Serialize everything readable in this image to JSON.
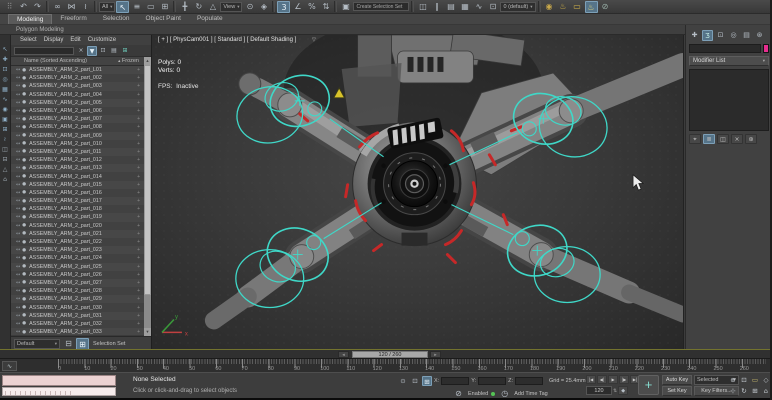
{
  "colors": {
    "accent_teal": "#3fd8c8",
    "marker_red": "#c62828",
    "object_color_swatch": "#e62e8f",
    "autokey": "#4a4a4a"
  },
  "toolbar_main": {
    "selection_set_placeholder": "Create Selection Set",
    "icons": [
      {
        "name": "toolbar-grip-icon",
        "glyph": "⠿",
        "color": "#7f7f7f"
      },
      {
        "name": "undo-icon",
        "glyph": "↶"
      },
      {
        "name": "redo-icon",
        "glyph": "↷"
      },
      {
        "type": "sep"
      },
      {
        "name": "select-and-link-icon",
        "glyph": "∞"
      },
      {
        "name": "unlink-selection-icon",
        "glyph": "⋈"
      },
      {
        "name": "bind-to-spacewarp-icon",
        "glyph": "≀"
      },
      {
        "type": "sep"
      },
      {
        "name": "selection-filter-dropdown",
        "type": "dropdown",
        "label": "All"
      },
      {
        "name": "select-object-icon",
        "glyph": "↖",
        "active": true
      },
      {
        "name": "select-by-name-icon",
        "glyph": "≡"
      },
      {
        "name": "selection-region-icon",
        "glyph": "▭"
      },
      {
        "name": "window-crossing-icon",
        "glyph": "⊞"
      },
      {
        "type": "sep"
      },
      {
        "name": "select-move-icon",
        "glyph": "╋"
      },
      {
        "name": "select-rotate-icon",
        "glyph": "↻"
      },
      {
        "name": "select-scale-icon",
        "glyph": "△"
      },
      {
        "name": "reference-coordinate-dropdown",
        "type": "dropdown",
        "label": "View"
      },
      {
        "name": "use-center-icon",
        "glyph": "⊙"
      },
      {
        "name": "select-manipulate-icon",
        "glyph": "◈"
      },
      {
        "type": "sep"
      },
      {
        "name": "snaps-toggle-icon",
        "glyph": "3",
        "active": true
      },
      {
        "name": "angle-snap-icon",
        "glyph": "∠"
      },
      {
        "name": "percent-snap-icon",
        "glyph": "%"
      },
      {
        "name": "spinner-snap-icon",
        "glyph": "⇅"
      },
      {
        "type": "sep"
      },
      {
        "name": "edit-named-sets-icon",
        "glyph": "▣"
      },
      {
        "name": "named-selection-set-field",
        "type": "input",
        "value": "Create Selection Set"
      },
      {
        "type": "sep"
      },
      {
        "name": "mirror-icon",
        "glyph": "◫"
      },
      {
        "name": "align-icon",
        "glyph": "∥"
      },
      {
        "name": "layer-manager-icon",
        "glyph": "▤"
      },
      {
        "name": "toggle-ribbon-icon",
        "glyph": "▦"
      },
      {
        "name": "curve-editor-icon",
        "glyph": "∿"
      },
      {
        "name": "schematic-view-icon",
        "glyph": "⊡"
      },
      {
        "name": "layer-dropdown",
        "type": "dropdown",
        "label": "0 (default)"
      },
      {
        "type": "sep"
      },
      {
        "name": "material-editor-icon",
        "glyph": "◉",
        "color": "#c8a84b"
      },
      {
        "name": "render-setup-icon",
        "glyph": "♨",
        "color": "#d8b84a"
      },
      {
        "name": "rendered-frame-window-icon",
        "glyph": "▭",
        "color": "#d8b84a"
      },
      {
        "name": "render-production-icon",
        "glyph": "♨",
        "color": "#eadc7a",
        "active": true
      },
      {
        "name": "render-iterative-icon",
        "glyph": "⊘",
        "color": "#9ab0a8"
      }
    ]
  },
  "ribbon": {
    "tabs": [
      {
        "label": "Modeling",
        "active": true
      },
      {
        "label": "Freeform",
        "active": false
      },
      {
        "label": "Selection",
        "active": false
      },
      {
        "label": "Object Paint",
        "active": false
      },
      {
        "label": "Populate",
        "active": false
      }
    ],
    "panel_label": "Polygon Modeling"
  },
  "explorer": {
    "menu": [
      "Select",
      "Display",
      "Edit",
      "Customize"
    ],
    "search_value": "",
    "search_icons": [
      {
        "name": "clear-search-icon",
        "glyph": "×"
      },
      {
        "name": "find-filter-icon",
        "glyph": "▼",
        "active": true
      },
      {
        "name": "lock-explorer-icon",
        "glyph": "⊡"
      },
      {
        "name": "sync-selection-icon",
        "glyph": "▤"
      },
      {
        "name": "pick-parent-icon",
        "glyph": "⊞",
        "color": "#6cc8b8"
      }
    ],
    "column_name": "Name (Sorted Ascending)",
    "sort_arrow": "▴",
    "column_frozen": "Frozen",
    "row_icons": {
      "link": "↔",
      "dot": "●",
      "frozen": "+"
    },
    "rows": [
      "ASSEMBLY_ARM_2_part_L01",
      "ASSEMBLY_ARM_2_part_002",
      "ASSEMBLY_ARM_2_part_003",
      "ASSEMBLY_ARM_2_part_004",
      "ASSEMBLY_ARM_2_part_005",
      "ASSEMBLY_ARM_2_part_006",
      "ASSEMBLY_ARM_2_part_007",
      "ASSEMBLY_ARM_2_part_008",
      "ASSEMBLY_ARM_2_part_009",
      "ASSEMBLY_ARM_2_part_010",
      "ASSEMBLY_ARM_2_part_011",
      "ASSEMBLY_ARM_2_part_012",
      "ASSEMBLY_ARM_2_part_013",
      "ASSEMBLY_ARM_2_part_014",
      "ASSEMBLY_ARM_2_part_015",
      "ASSEMBLY_ARM_2_part_016",
      "ASSEMBLY_ARM_2_part_017",
      "ASSEMBLY_ARM_2_part_018",
      "ASSEMBLY_ARM_2_part_019",
      "ASSEMBLY_ARM_2_part_020",
      "ASSEMBLY_ARM_2_part_021",
      "ASSEMBLY_ARM_2_part_022",
      "ASSEMBLY_ARM_2_part_023",
      "ASSEMBLY_ARM_2_part_024",
      "ASSEMBLY_ARM_2_part_025",
      "ASSEMBLY_ARM_2_part_026",
      "ASSEMBLY_ARM_2_part_027",
      "ASSEMBLY_ARM_2_part_028",
      "ASSEMBLY_ARM_2_part_029",
      "ASSEMBLY_ARM_2_part_030",
      "ASSEMBLY_ARM_2_part_031",
      "ASSEMBLY_ARM_2_part_032",
      "ASSEMBLY_ARM_2_part_033"
    ],
    "side_icons": [
      {
        "name": "explorer-select-icon",
        "glyph": "↖",
        "color": "#8fb0c8"
      },
      {
        "name": "explorer-pan-icon",
        "glyph": "✚",
        "color": "#8fb0c8"
      },
      {
        "name": "explorer-lock-icon",
        "glyph": "⊡",
        "color": "#8fb0c8"
      },
      {
        "name": "explorer-pin-icon",
        "glyph": "◎",
        "color": "#8fb0c8"
      },
      {
        "name": "explorer-geometry-icon",
        "glyph": "▦",
        "color": "#8fb0c8"
      },
      {
        "name": "explorer-shapes-icon",
        "glyph": "∿",
        "color": "#8fb0c8"
      },
      {
        "name": "explorer-lights-icon",
        "glyph": "◉",
        "color": "#8fb0c8"
      },
      {
        "name": "explorer-cameras-icon",
        "glyph": "▣",
        "color": "#8fb0c8"
      },
      {
        "name": "explorer-helpers-icon",
        "glyph": "⊞",
        "color": "#8fb0c8"
      },
      {
        "name": "explorer-spacewarps-icon",
        "glyph": "≀",
        "color": "#8fb0c8"
      },
      {
        "name": "explorer-groups-icon",
        "glyph": "◫",
        "color": "#9aa5ad"
      },
      {
        "name": "explorer-xrefs-icon",
        "glyph": "⊟",
        "color": "#9aa5ad"
      },
      {
        "name": "explorer-bones-icon",
        "glyph": "△",
        "color": "#9aa5ad"
      },
      {
        "name": "explorer-containers-icon",
        "glyph": "⌂",
        "color": "#9aa5ad"
      }
    ],
    "footer_dropdown": "Default",
    "footer_icons": [
      {
        "name": "delete-set-icon",
        "glyph": "⊟"
      },
      {
        "name": "new-set-icon",
        "glyph": "⊞",
        "active": true
      }
    ],
    "footer_label": "Selection Set"
  },
  "viewport": {
    "label": "[ + ] [ PhysCam001 ] [ Standard ] [ Default Shading ]",
    "funnel": "▽",
    "stats": {
      "polys_label": "Polys:",
      "polys": "0",
      "verts_label": "Verts:",
      "verts": "0",
      "fps_label": "FPS:",
      "fps": "Inactive"
    }
  },
  "command_panel": {
    "tabs": [
      {
        "name": "create-tab-icon",
        "glyph": "✚"
      },
      {
        "name": "modify-tab-icon",
        "glyph": "Ʒ",
        "active": true,
        "color": "#bfe8e2"
      },
      {
        "name": "hierarchy-tab-icon",
        "glyph": "⊡"
      },
      {
        "name": "motion-tab-icon",
        "glyph": "◎"
      },
      {
        "name": "display-tab-icon",
        "glyph": "▤"
      },
      {
        "name": "utilities-tab-icon",
        "glyph": "⊛"
      }
    ],
    "object_name_value": "",
    "modifier_list_label": "Modifier List",
    "stack_buttons": [
      {
        "name": "pin-stack-icon",
        "glyph": "⌖"
      },
      {
        "name": "show-end-result-icon",
        "glyph": "≣",
        "active": true
      },
      {
        "name": "make-unique-icon",
        "glyph": "◫"
      },
      {
        "name": "remove-modifier-icon",
        "glyph": "×"
      },
      {
        "name": "configure-modifier-icon",
        "glyph": "⊛"
      }
    ]
  },
  "timeline": {
    "slider_label": "120 / 260",
    "tick_start": 0,
    "tick_end": 260,
    "tick_step": 10
  },
  "status": {
    "selected": "None Selected",
    "prompt": "Click or click-and-drag to select objects",
    "isolate_glyph": "⊙",
    "lock_glyph": "⊡",
    "abs_mode_glyph": "⊞",
    "x_label": "X:",
    "y_label": "Y:",
    "z_label": "Z:",
    "grid": "Grid = 25.4mm",
    "degradation_glyph": "⊘",
    "enabled": "Enabled",
    "timetag_glyph": "◷",
    "add_time_tag": "Add Time Tag",
    "playback": [
      {
        "name": "go-to-start-button",
        "glyph": "|◀"
      },
      {
        "name": "previous-frame-button",
        "glyph": "◀|"
      },
      {
        "name": "play-button",
        "glyph": "▶"
      },
      {
        "name": "next-frame-button",
        "glyph": "|▶"
      },
      {
        "name": "go-to-end-button",
        "glyph": "▶|"
      }
    ],
    "frame": "120",
    "spinner_glyph": "⇅",
    "key_mode_glyph": "◆",
    "plus_label": "+",
    "auto_key": "Auto Key",
    "set_key": "Set Key",
    "selected_dropdown": "Selected",
    "key_filters": "Key Filters...",
    "nav_row1": [
      {
        "name": "zoom-icon",
        "glyph": "⊕"
      },
      {
        "name": "zoom-all-icon",
        "glyph": "⊡"
      },
      {
        "name": "zoom-extents-icon",
        "glyph": "▭",
        "color": "#d0c070"
      },
      {
        "name": "field-of-view-icon",
        "glyph": "◇"
      }
    ],
    "nav_row2": [
      {
        "name": "pan-icon",
        "glyph": "⊹"
      },
      {
        "name": "orbit-icon",
        "glyph": "↻"
      },
      {
        "name": "maximize-viewport-icon",
        "glyph": "⊞"
      },
      {
        "name": "viewport-home-icon",
        "glyph": "⌂"
      }
    ]
  }
}
